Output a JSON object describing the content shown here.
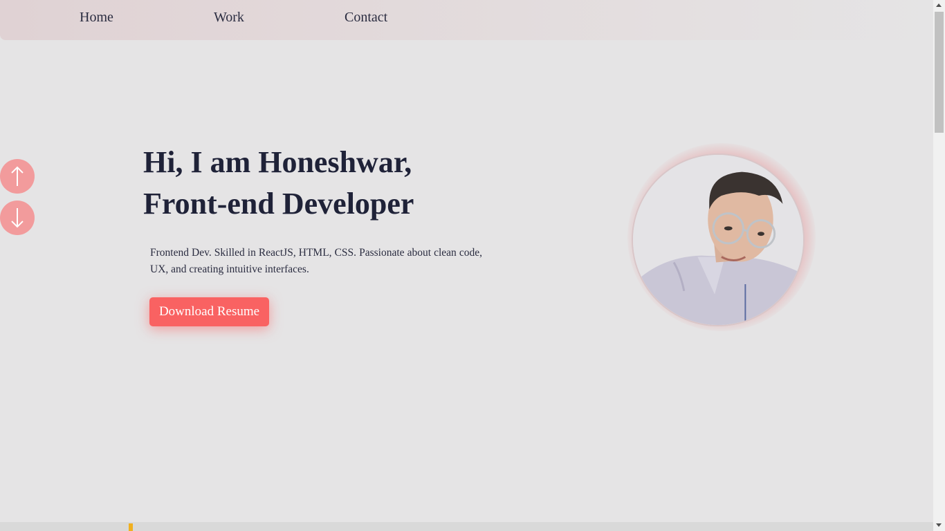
{
  "nav": {
    "items": [
      {
        "label": "Home"
      },
      {
        "label": "Work"
      },
      {
        "label": "Contact"
      }
    ]
  },
  "side_controls": {
    "up_icon": "arrow-up-icon",
    "down_icon": "arrow-down-icon",
    "color": "#f29b9c"
  },
  "hero": {
    "heading_line1": "Hi, I am Honeshwar,",
    "heading_line2": "Front-end Developer",
    "description": "Frontend Dev. Skilled in ReactJS, HTML, CSS. Passionate about clean code, UX, and creating intuitive interfaces.",
    "cta_label": "Download Resume",
    "cta_color": "#f96262"
  },
  "profile": {
    "image": "profile-photo"
  },
  "colors": {
    "background": "#e5e4e5",
    "text": "#1f2238",
    "accent": "#f96262"
  }
}
